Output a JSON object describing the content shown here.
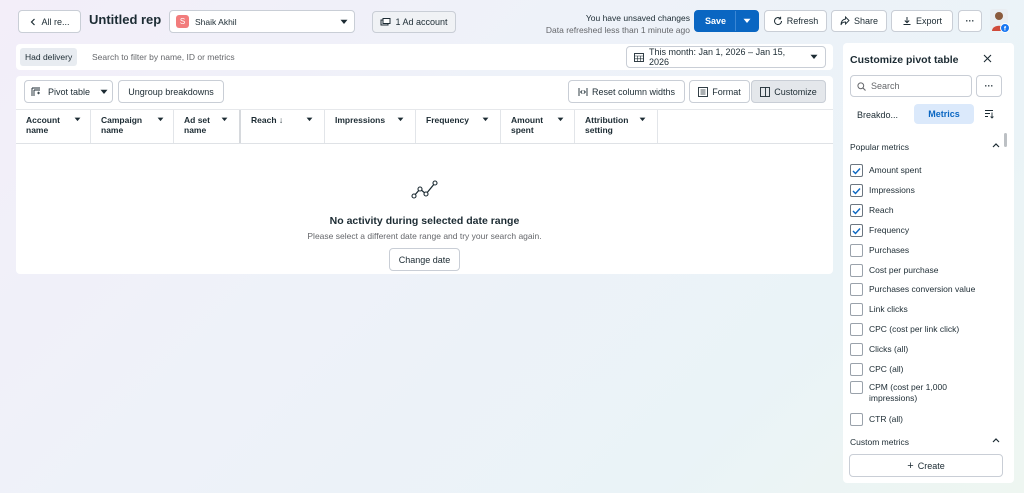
{
  "header": {
    "back_label": "All re...",
    "title": "Untitled rep",
    "account_initial": "S",
    "account_name": "Shaik Akhil",
    "ad_account_label": "1 Ad account",
    "unsaved_line1": "You have unsaved changes",
    "unsaved_line2": "Data refreshed less than 1 minute ago",
    "save_label": "Save",
    "refresh_label": "Refresh",
    "share_label": "Share",
    "export_label": "Export",
    "more_label": "···"
  },
  "filter": {
    "chip": "Had delivery",
    "placeholder": "Search to filter by name, ID or metrics",
    "date_range": "This month: Jan 1, 2026 – Jan 15, 2026"
  },
  "toolbar": {
    "pivot_label": "Pivot table",
    "ungroup_label": "Ungroup breakdowns",
    "reset_label": "Reset column widths",
    "format_label": "Format",
    "customize_label": "Customize"
  },
  "columns": [
    {
      "line1": "Account",
      "line2": "name"
    },
    {
      "line1": "Campaign",
      "line2": "name"
    },
    {
      "line1": "Ad set",
      "line2": "name"
    },
    {
      "line1": "Reach ↓",
      "line2": ""
    },
    {
      "line1": "Impressions",
      "line2": ""
    },
    {
      "line1": "Frequency",
      "line2": ""
    },
    {
      "line1": "Amount",
      "line2": "spent"
    },
    {
      "line1": "Attribution",
      "line2": "setting"
    }
  ],
  "empty": {
    "title": "No activity during selected date range",
    "subtitle": "Please select a different date range and try your search again.",
    "button": "Change date"
  },
  "side": {
    "title": "Customize pivot table",
    "search_placeholder": "Search",
    "more_label": "···",
    "tab_breakdowns": "Breakdo...",
    "tab_metrics": "Metrics",
    "popular_heading": "Popular metrics",
    "custom_heading": "Custom metrics",
    "create_label": "Create",
    "metrics": [
      {
        "label": "Amount spent",
        "checked": true
      },
      {
        "label": "Impressions",
        "checked": true
      },
      {
        "label": "Reach",
        "checked": true
      },
      {
        "label": "Frequency",
        "checked": true
      },
      {
        "label": "Purchases",
        "checked": false
      },
      {
        "label": "Cost per purchase",
        "checked": false
      },
      {
        "label": "Purchases conversion value",
        "checked": false
      },
      {
        "label": "Link clicks",
        "checked": false
      },
      {
        "label": "CPC (cost per link click)",
        "checked": false
      },
      {
        "label": "Clicks (all)",
        "checked": false
      },
      {
        "label": "CPC (all)",
        "checked": false
      },
      {
        "label": "CPM (cost per 1,000 impressions)",
        "checked": false
      },
      {
        "label": "CTR (all)",
        "checked": false
      }
    ]
  },
  "colors": {
    "accent": "#0a66c2",
    "tab_active_bg": "#dbe9fb",
    "check": "#0a66c2"
  }
}
